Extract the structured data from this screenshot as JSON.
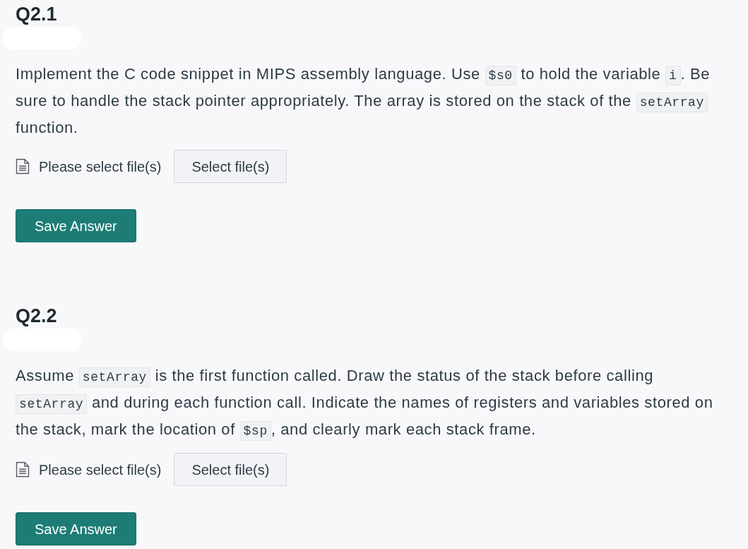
{
  "questions": [
    {
      "title": "Q2.1",
      "prompt": [
        {
          "kind": "text",
          "text": "Implement the C code snippet in MIPS assembly language. Use "
        },
        {
          "kind": "code",
          "text": "$s0"
        },
        {
          "kind": "text",
          "text": " to hold the variable "
        },
        {
          "kind": "code",
          "text": "i"
        },
        {
          "kind": "text",
          "text": ". Be sure to handle the stack pointer appropriately. The array is stored on the stack of the "
        },
        {
          "kind": "code",
          "text": "setArray"
        },
        {
          "kind": "text",
          "text": " function."
        }
      ],
      "file_status": "Please select file(s)",
      "select_button": "Select file(s)",
      "save_button": "Save Answer"
    },
    {
      "title": "Q2.2",
      "prompt": [
        {
          "kind": "text",
          "text": "Assume "
        },
        {
          "kind": "code",
          "text": "setArray"
        },
        {
          "kind": "text",
          "text": " is the first function called. Draw the status of the stack before calling "
        },
        {
          "kind": "code",
          "text": "setArray"
        },
        {
          "kind": "text",
          "text": " and during each function call. Indicate the names of registers and variables stored on the stack, mark the location of "
        },
        {
          "kind": "code",
          "text": "$sp"
        },
        {
          "kind": "text",
          "text": ", and clearly mark each stack frame."
        }
      ],
      "file_status": "Please select file(s)",
      "select_button": "Select file(s)",
      "save_button": "Save Answer"
    }
  ]
}
